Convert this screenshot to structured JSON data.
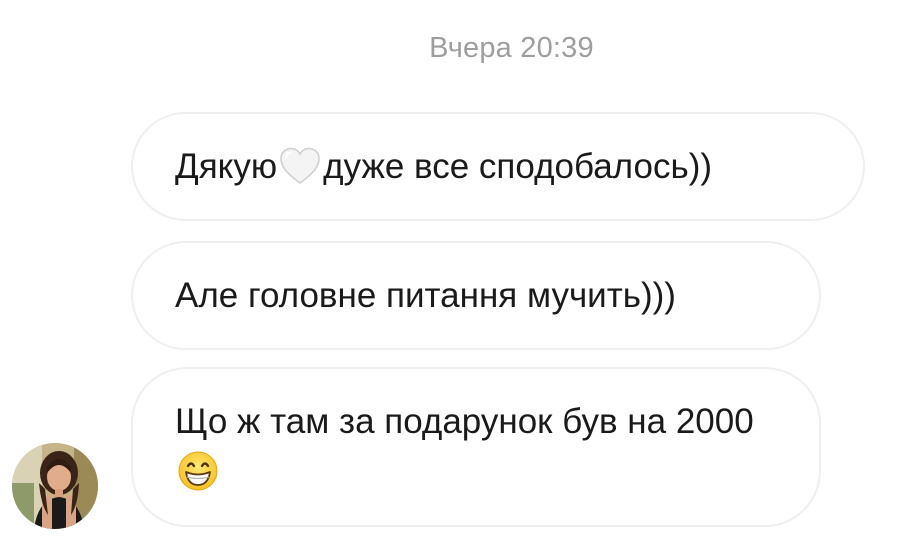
{
  "thread": {
    "timestamp": "Вчера 20:39"
  },
  "messages": [
    {
      "before": "Дякую",
      "emoji": "white-heart-icon",
      "after": "дуже все сподобалось))"
    },
    {
      "text": "Але головне питання мучить)))"
    },
    {
      "text": "Що ж там за подарунок був на 2000",
      "emoji": "grinning-face-icon"
    }
  ],
  "sender": {
    "avatar": "profile-photo"
  }
}
